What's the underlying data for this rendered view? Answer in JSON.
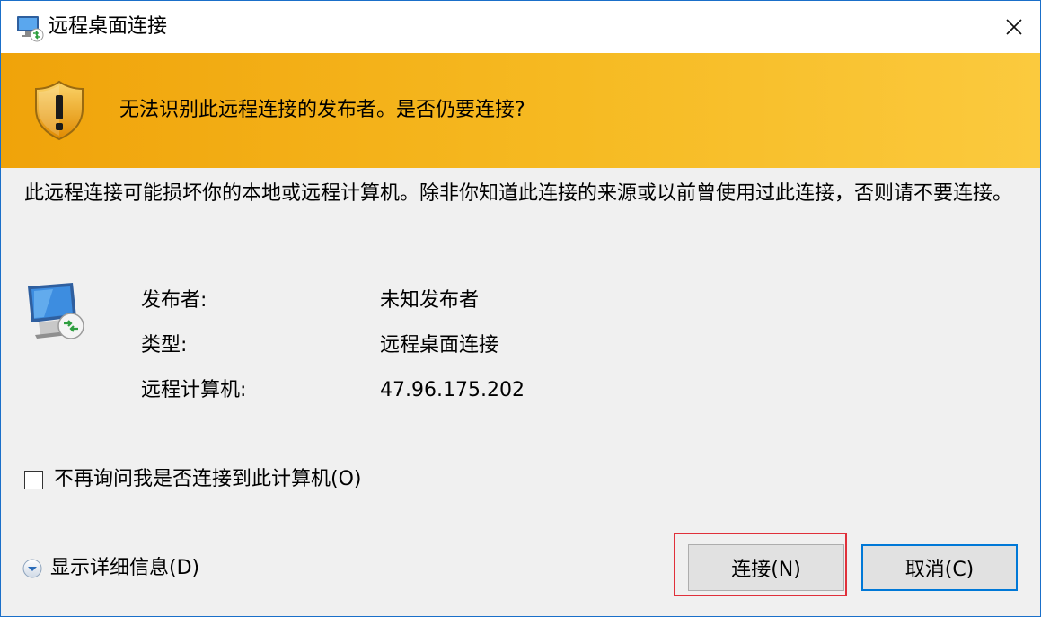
{
  "window": {
    "title": "远程桌面连接",
    "close_icon": "close-icon",
    "border_color": "#1a6fc9"
  },
  "banner": {
    "text": "无法识别此远程连接的发布者。是否仍要连接?",
    "icon": "warning-shield-icon",
    "color": "#f0a30a"
  },
  "warning_text": "此远程连接可能损坏你的本地或远程计算机。除非你知道此连接的来源或以前曾使用过此连接，否则请不要连接。",
  "details": {
    "icon": "remote-desktop-icon",
    "rows": [
      {
        "label": "发布者:",
        "value": "未知发布者"
      },
      {
        "label": "类型:",
        "value": "远程桌面连接"
      },
      {
        "label": "远程计算机:",
        "value": "47.96.175.202"
      }
    ]
  },
  "checkbox": {
    "label": "不再询问我是否连接到此计算机(O)",
    "checked": false
  },
  "show_details": {
    "label": "显示详细信息(D)",
    "icon": "chevron-down-icon"
  },
  "buttons": {
    "connect": "连接(N)",
    "cancel": "取消(C)"
  },
  "highlight_color": "#e0303a"
}
